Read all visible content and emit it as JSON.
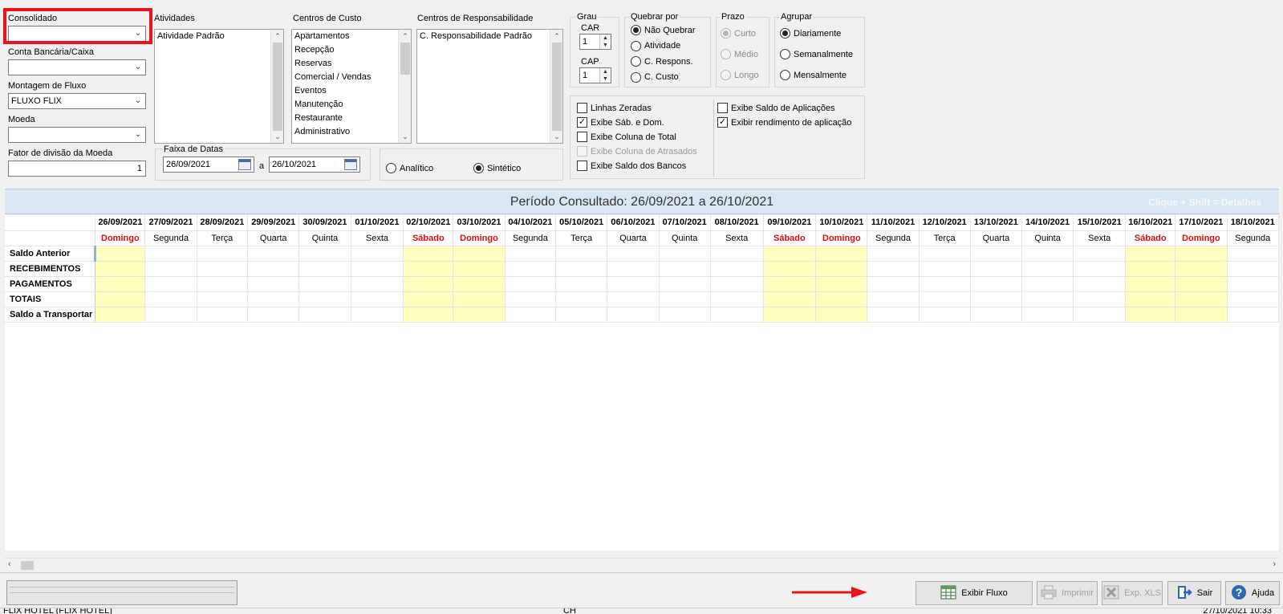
{
  "filters": {
    "consolidado": {
      "label": "Consolidado",
      "value": ""
    },
    "conta": {
      "label": "Conta Bancária/Caixa",
      "value": ""
    },
    "montagem": {
      "label": "Montagem de Fluxo",
      "value": "FLUXO FLIX"
    },
    "moeda": {
      "label": "Moeda",
      "value": ""
    },
    "fator": {
      "label": "Fator de divisão da Moeda",
      "value": "1"
    }
  },
  "atividades": {
    "label": "Atividades",
    "items": [
      "Atividade Padrão"
    ]
  },
  "centros_custo": {
    "label": "Centros de Custo",
    "items": [
      "Apartamentos",
      "Recepção",
      "Reservas",
      "Comercial / Vendas",
      "Eventos",
      "Manutenção",
      "Restaurante",
      "Administrativo"
    ]
  },
  "centros_resp": {
    "label": "Centros de Responsabilidade",
    "items": [
      "C. Responsabilidade Padrão"
    ]
  },
  "faixa": {
    "label": "Faixa de Datas",
    "from": "26/09/2021",
    "sep": "a",
    "to": "26/10/2021"
  },
  "tipo": {
    "analitico": "Analítico",
    "sintetico": "Sintético",
    "selected": "sintetico"
  },
  "grau": {
    "label": "Grau",
    "car_label": "CAR",
    "car_value": "1",
    "cap_label": "CAP",
    "cap_value": "1"
  },
  "quebrar": {
    "label": "Quebrar por",
    "options": [
      "Não Quebrar",
      "Atividade",
      "C. Respons.",
      "C. Custo"
    ],
    "selected": 0
  },
  "prazo": {
    "label": "Prazo",
    "options": [
      "Curto",
      "Médio",
      "Longo"
    ],
    "selected": 0
  },
  "agrupar": {
    "label": "Agrupar",
    "options": [
      "Diariamente",
      "Semanalmente",
      "Mensalmente"
    ],
    "selected": 0
  },
  "opcoes": {
    "left": [
      {
        "label": "Linhas Zeradas",
        "checked": false,
        "disabled": false
      },
      {
        "label": "Exibe Sáb. e Dom.",
        "checked": true,
        "disabled": false
      },
      {
        "label": "Exibe Coluna de Total",
        "checked": false,
        "disabled": false
      },
      {
        "label": "Exibe Coluna de Atrasados",
        "checked": false,
        "disabled": true
      },
      {
        "label": "Exibe Saldo dos Bancos",
        "checked": false,
        "disabled": false
      }
    ],
    "right": [
      {
        "label": "Exibe Saldo de Aplicações",
        "checked": false,
        "disabled": false
      },
      {
        "label": "Exibir rendimento de aplicação",
        "checked": true,
        "disabled": false
      }
    ]
  },
  "banner": {
    "title": "Período Consultado: 26/09/2021 a 26/10/2021",
    "hint": "Clique + Shift = Detalhes"
  },
  "grid": {
    "dates": [
      "26/09/2021",
      "27/09/2021",
      "28/09/2021",
      "29/09/2021",
      "30/09/2021",
      "01/10/2021",
      "02/10/2021",
      "03/10/2021",
      "04/10/2021",
      "05/10/2021",
      "06/10/2021",
      "07/10/2021",
      "08/10/2021",
      "09/10/2021",
      "10/10/2021",
      "11/10/2021",
      "12/10/2021",
      "13/10/2021",
      "14/10/2021",
      "15/10/2021",
      "16/10/2021",
      "17/10/2021",
      "18/10/2021"
    ],
    "days": [
      "Domingo",
      "Segunda",
      "Terça",
      "Quarta",
      "Quinta",
      "Sexta",
      "Sábado",
      "Domingo",
      "Segunda",
      "Terça",
      "Quarta",
      "Quinta",
      "Sexta",
      "Sábado",
      "Domingo",
      "Segunda",
      "Terça",
      "Quarta",
      "Quinta",
      "Sexta",
      "Sábado",
      "Domingo",
      "Segunda"
    ],
    "rows": [
      "Saldo Anterior",
      "RECEBIMENTOS",
      "PAGAMENTOS",
      "TOTAIS",
      "Saldo a Transportar"
    ]
  },
  "toolbar": {
    "exibir": "Exibir Fluxo",
    "imprimir": "Imprimir",
    "xls": "Exp. XLS",
    "sair": "Sair",
    "ajuda": "Ajuda"
  },
  "statusbar": {
    "left": "FLIX HOTEL (FLIX HOTEL)",
    "mid": "CH",
    "right": "27/10/2021 10:33"
  },
  "colors": {
    "highlight": "#e8141a",
    "arrow": "#e8141a",
    "banner_bg": "#d9e6f3",
    "weekend_bg": "#ffffc0",
    "weekend_text": "#d01010"
  }
}
